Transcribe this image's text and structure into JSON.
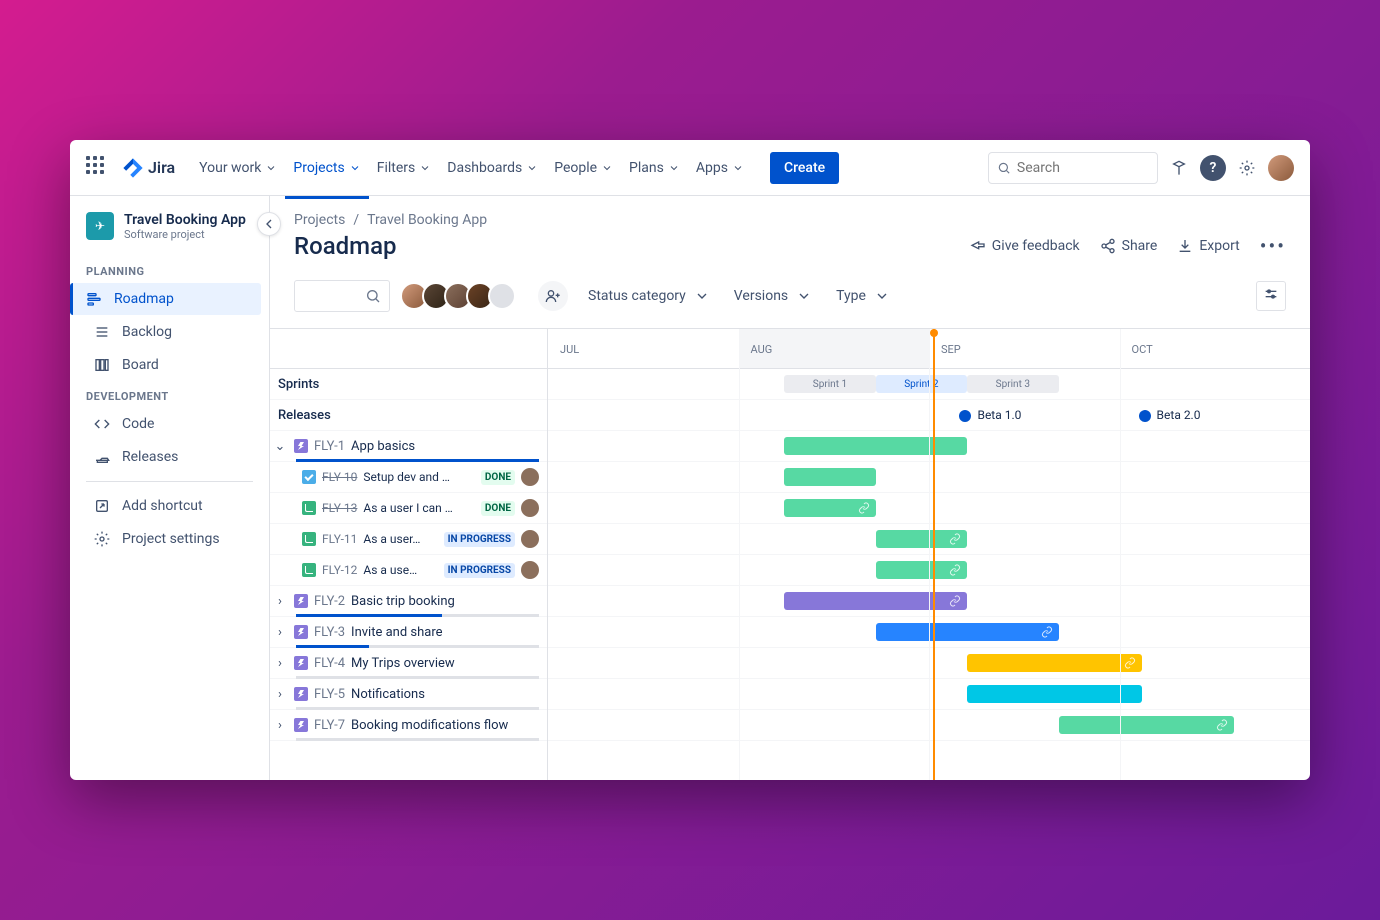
{
  "nav": {
    "product": "Jira",
    "items": [
      "Your work",
      "Projects",
      "Filters",
      "Dashboards",
      "People",
      "Plans",
      "Apps"
    ],
    "active_index": 1,
    "create_label": "Create",
    "search_placeholder": "Search"
  },
  "sidebar": {
    "project_name": "Travel Booking App",
    "project_type": "Software project",
    "sections": [
      {
        "label": "PLANNING",
        "items": [
          {
            "icon": "roadmap",
            "label": "Roadmap",
            "selected": true
          },
          {
            "icon": "backlog",
            "label": "Backlog"
          },
          {
            "icon": "board",
            "label": "Board"
          }
        ]
      },
      {
        "label": "DEVELOPMENT",
        "items": [
          {
            "icon": "code",
            "label": "Code"
          },
          {
            "icon": "releases",
            "label": "Releases"
          }
        ]
      }
    ],
    "bottom": [
      {
        "icon": "shortcut",
        "label": "Add shortcut"
      },
      {
        "icon": "settings",
        "label": "Project settings"
      }
    ]
  },
  "breadcrumb": [
    "Projects",
    "Travel Booking App"
  ],
  "page_title": "Roadmap",
  "actions": {
    "feedback": "Give feedback",
    "share": "Share",
    "export": "Export"
  },
  "filters": {
    "status": "Status category",
    "versions": "Versions",
    "type": "Type"
  },
  "timeline": {
    "months": [
      "JUL",
      "AUG",
      "SEP",
      "OCT"
    ],
    "today_month_index": 1,
    "today_pct": 50.5,
    "sprints_label": "Sprints",
    "releases_label": "Releases",
    "sprints": [
      {
        "name": "Sprint 1",
        "start": 31,
        "end": 43,
        "cls": "sp-gray"
      },
      {
        "name": "Sprint 2",
        "start": 43,
        "end": 55,
        "cls": "sp-blue"
      },
      {
        "name": "Sprint 3",
        "start": 55,
        "end": 67,
        "cls": "sp-gray"
      }
    ],
    "releases": [
      {
        "name": "Beta 1.0",
        "pos": 54
      },
      {
        "name": "Beta 2.0",
        "pos": 77.5
      }
    ],
    "epics": [
      {
        "key": "FLY-1",
        "summary": "App basics",
        "expanded": true,
        "progress": 100,
        "bar": {
          "start": 31,
          "end": 55,
          "color": "c-green"
        },
        "children": [
          {
            "key": "FLY-10",
            "summary": "Setup dev and …",
            "type": "task",
            "status": "DONE",
            "status_cls": "status-done",
            "strike": true,
            "bar": {
              "start": 31,
              "end": 43,
              "color": "c-green"
            }
          },
          {
            "key": "FLY-13",
            "summary": "As a user I can …",
            "type": "story",
            "status": "DONE",
            "status_cls": "status-done",
            "strike": true,
            "bar": {
              "start": 31,
              "end": 43,
              "color": "c-green",
              "link": true
            }
          },
          {
            "key": "FLY-11",
            "summary": "As a user…",
            "type": "story",
            "status": "IN PROGRESS",
            "status_cls": "status-prog",
            "bar": {
              "start": 43,
              "end": 55,
              "color": "c-green",
              "link": true
            }
          },
          {
            "key": "FLY-12",
            "summary": "As a use…",
            "type": "story",
            "status": "IN PROGRESS",
            "status_cls": "status-prog",
            "bar": {
              "start": 43,
              "end": 55,
              "color": "c-green",
              "link": true
            }
          }
        ]
      },
      {
        "key": "FLY-2",
        "summary": "Basic trip booking",
        "progress": 60,
        "bar": {
          "start": 31,
          "end": 55,
          "color": "c-purple",
          "link": true
        }
      },
      {
        "key": "FLY-3",
        "summary": "Invite and share",
        "progress": 30,
        "bar": {
          "start": 43,
          "end": 67,
          "color": "c-blue",
          "link": true
        }
      },
      {
        "key": "FLY-4",
        "summary": "My Trips overview",
        "progress": 0,
        "bar": {
          "start": 55,
          "end": 78,
          "color": "c-yellow",
          "link": true
        }
      },
      {
        "key": "FLY-5",
        "summary": "Notifications",
        "progress": 0,
        "bar": {
          "start": 55,
          "end": 78,
          "color": "c-cyan"
        }
      },
      {
        "key": "FLY-7",
        "summary": "Booking modifications flow",
        "progress": 0,
        "bar": {
          "start": 67,
          "end": 90,
          "color": "c-green",
          "link": true
        }
      }
    ]
  }
}
